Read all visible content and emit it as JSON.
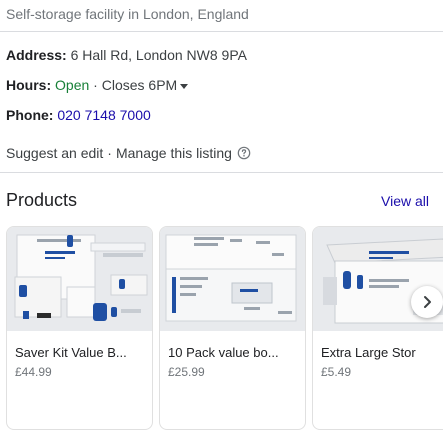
{
  "subtitle": "Self-storage facility in London, England",
  "address": {
    "label": "Address:",
    "value": "6 Hall Rd, London NW8 9PA"
  },
  "hours": {
    "label": "Hours:",
    "status": "Open",
    "separator": "·",
    "closes": "Closes 6PM"
  },
  "phone": {
    "label": "Phone:",
    "value": "020 7148 7000"
  },
  "suggest": {
    "edit_label": "Suggest an edit",
    "separator": "·",
    "manage_label": "Manage this listing",
    "icon": "help-circle-icon"
  },
  "products": {
    "title": "Products",
    "view_all_label": "View all",
    "items": [
      {
        "name": "Saver Kit Value B...",
        "price": "£44.99",
        "image": "box-kit-image"
      },
      {
        "name": "10 Pack value bo...",
        "price": "£25.99",
        "image": "flat-boxes-image"
      },
      {
        "name": "Extra Large Stor",
        "price": "£5.49",
        "image": "large-box-image"
      }
    ],
    "next_icon": "chevron-right-icon"
  },
  "colors": {
    "link": "#1a0dab",
    "open": "#188038",
    "muted": "#70757a",
    "divider": "#dadce0",
    "brand_blue": "#1f4fa3"
  }
}
